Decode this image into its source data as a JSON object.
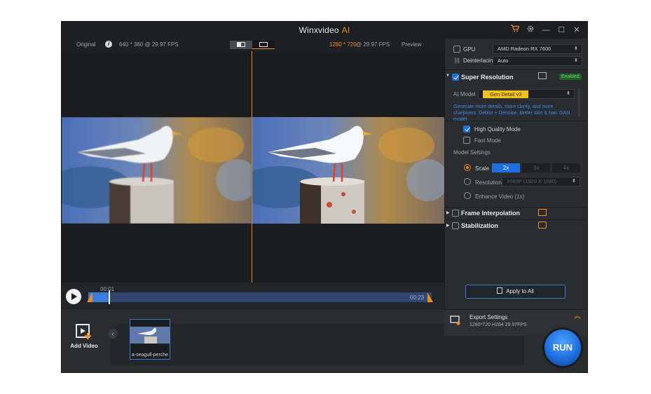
{
  "window": {
    "title": "Winxvideo",
    "title_ai": "AI",
    "accent": "#f08a24",
    "icons": [
      "cart-icon",
      "settings-icon",
      "minimize-icon",
      "maximize-icon",
      "close-icon"
    ]
  },
  "preview": {
    "original_label": "Original",
    "original_info": "640 * 360 @ 29.97 FPS",
    "output_res": "1280 * 720",
    "output_fps": "@ 29.97 FPS",
    "preview_label": "Preview"
  },
  "timeline": {
    "current_time": "00:01",
    "end_time": "00:23",
    "progress": 0.05
  },
  "settings": {
    "gpu_label": "GPU",
    "gpu_value": "AMD Radeon RX 7600",
    "deinterlacing_label": "Deinterlacing",
    "deinterlacing_value": "Auto",
    "super_resolution": {
      "title": "Super Resolution",
      "badge": "Enabled",
      "ai_model_label": "AI Model",
      "ai_model_value": "Gen Detail v3",
      "description": "Generate more details, more clarity, and more sharpness. Deblur + Denoise. Better skin & hair. GAN model.",
      "high_quality_mode": "High Quality Mode",
      "fast_mode": "Fast Mode",
      "model_settings_label": "Model Settings",
      "scale_label": "Scale",
      "scale_options": [
        "2x",
        "3x",
        "4x"
      ],
      "resolution_label": "Resolution",
      "resolution_value": "1080P (1920 X 1080)",
      "enhance_label": "Enhance Video (1x)"
    },
    "frame_interpolation": "Frame Interpolation",
    "stabilization": "Stabilization",
    "apply_all": "Apply to All"
  },
  "export": {
    "title": "Export Settings",
    "details": "1280*720  H264  29.97FPS"
  },
  "bottom": {
    "add_video": "Add Video",
    "clip_name": "a-seagull-perche",
    "run_label": "RUN"
  }
}
